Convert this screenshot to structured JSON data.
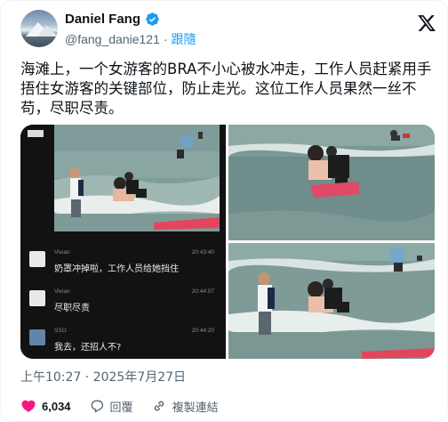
{
  "author": {
    "display_name": "Daniel Fang",
    "handle": "@fang_danie121",
    "separator": "·",
    "follow_label": "跟隨"
  },
  "tweet": {
    "text": "海滩上，一个女游客的BRA不小心被水冲走，工作人员赶紧用手捂住女游客的关键部位，防止走光。这位工作人员果然一丝不苟，尽职尽责。",
    "timestamp": "上午10:27 · 2025年7月27日"
  },
  "media": {
    "chat": [
      {
        "sender": "Vivian",
        "time": "20:43:40",
        "text": "奶罩冲掉啦，工作人员给她挡住"
      },
      {
        "sender": "Vivian",
        "time": "20:44:07",
        "text": "尽职尽责"
      },
      {
        "sender": "SSO",
        "time": "20:44:20",
        "text": "我去，还招人不?"
      }
    ]
  },
  "actions": {
    "likes_count": "6,034",
    "reply_label": "回覆",
    "copy_link_label": "複製連結"
  },
  "colors": {
    "like": "#f91880",
    "accent": "#1d9bf0",
    "verified": "#1d9bf0"
  },
  "icons": [
    "verified-badge-icon",
    "x-logo-icon",
    "heart-icon",
    "reply-icon",
    "link-icon"
  ]
}
